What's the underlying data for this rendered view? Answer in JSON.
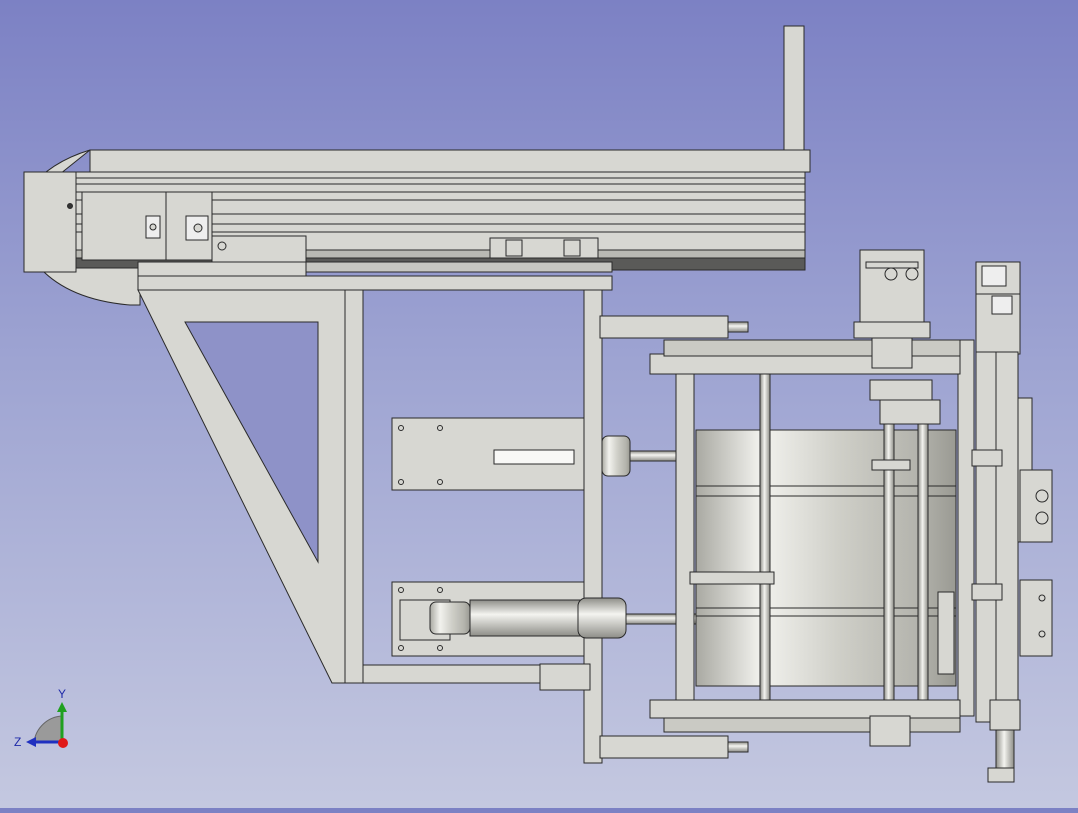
{
  "viewport": {
    "background_top": "#7c81c4",
    "background_bottom": "#c4c8e0",
    "part_color": "#d7d7d2",
    "edge_color": "#2a2a2a",
    "metal_light": "#f4f4f0",
    "metal_dark": "#8f8f88"
  },
  "triad": {
    "y_label": "Y",
    "z_label": "Z",
    "y_color": "#20a020",
    "z_color": "#2030c0",
    "x_color": "#e01818"
  }
}
